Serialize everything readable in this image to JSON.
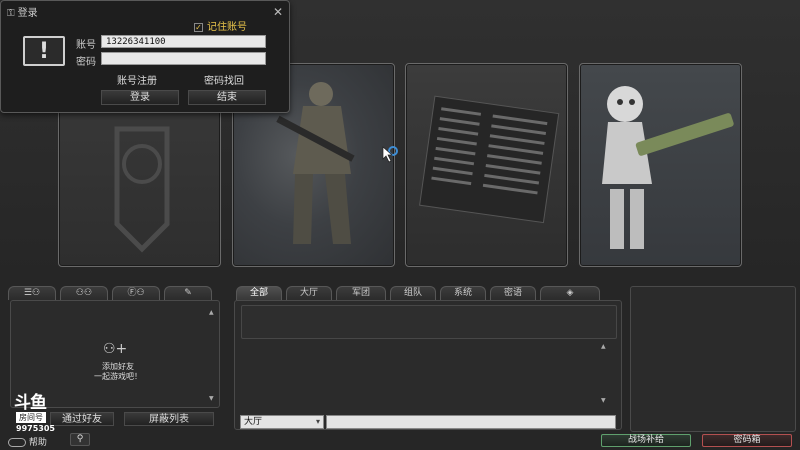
{
  "login": {
    "title": "登录",
    "close": "✕",
    "remember_label": "记住账号",
    "remember_check": "✓",
    "account_label": "账号",
    "account_value": "13226341100",
    "password_label": "密码",
    "password_value": "",
    "register_link": "账号注册",
    "recover_link": "密码找回",
    "login_button": "登录",
    "exit_button": "结束",
    "alert_glyph": "!"
  },
  "friends": {
    "tab_icons": [
      "list-icon",
      "group-icon",
      "search-friend-icon",
      "edit-icon"
    ],
    "add_line1": "添加好友",
    "add_line2": "一起游戏吧！",
    "add_glyph": "⚇+",
    "via_friend_button": "通过好友",
    "block_list_button": "屏蔽列表",
    "help_label": "帮助"
  },
  "chat": {
    "tabs": [
      "全部",
      "大厅",
      "军团",
      "组队",
      "系统",
      "密语"
    ],
    "channel_select": "大厅",
    "channel_caret": "▾"
  },
  "watermark": {
    "logo": "斗鱼",
    "room_label": "房间号",
    "room_number": "9975305"
  },
  "bottom_right": {
    "supply_button": "战场补给",
    "safe_button": "密码箱"
  },
  "colors": {
    "accent_gold": "#e9c44b",
    "green_border": "#5fa06d",
    "red_border": "#b45050"
  }
}
